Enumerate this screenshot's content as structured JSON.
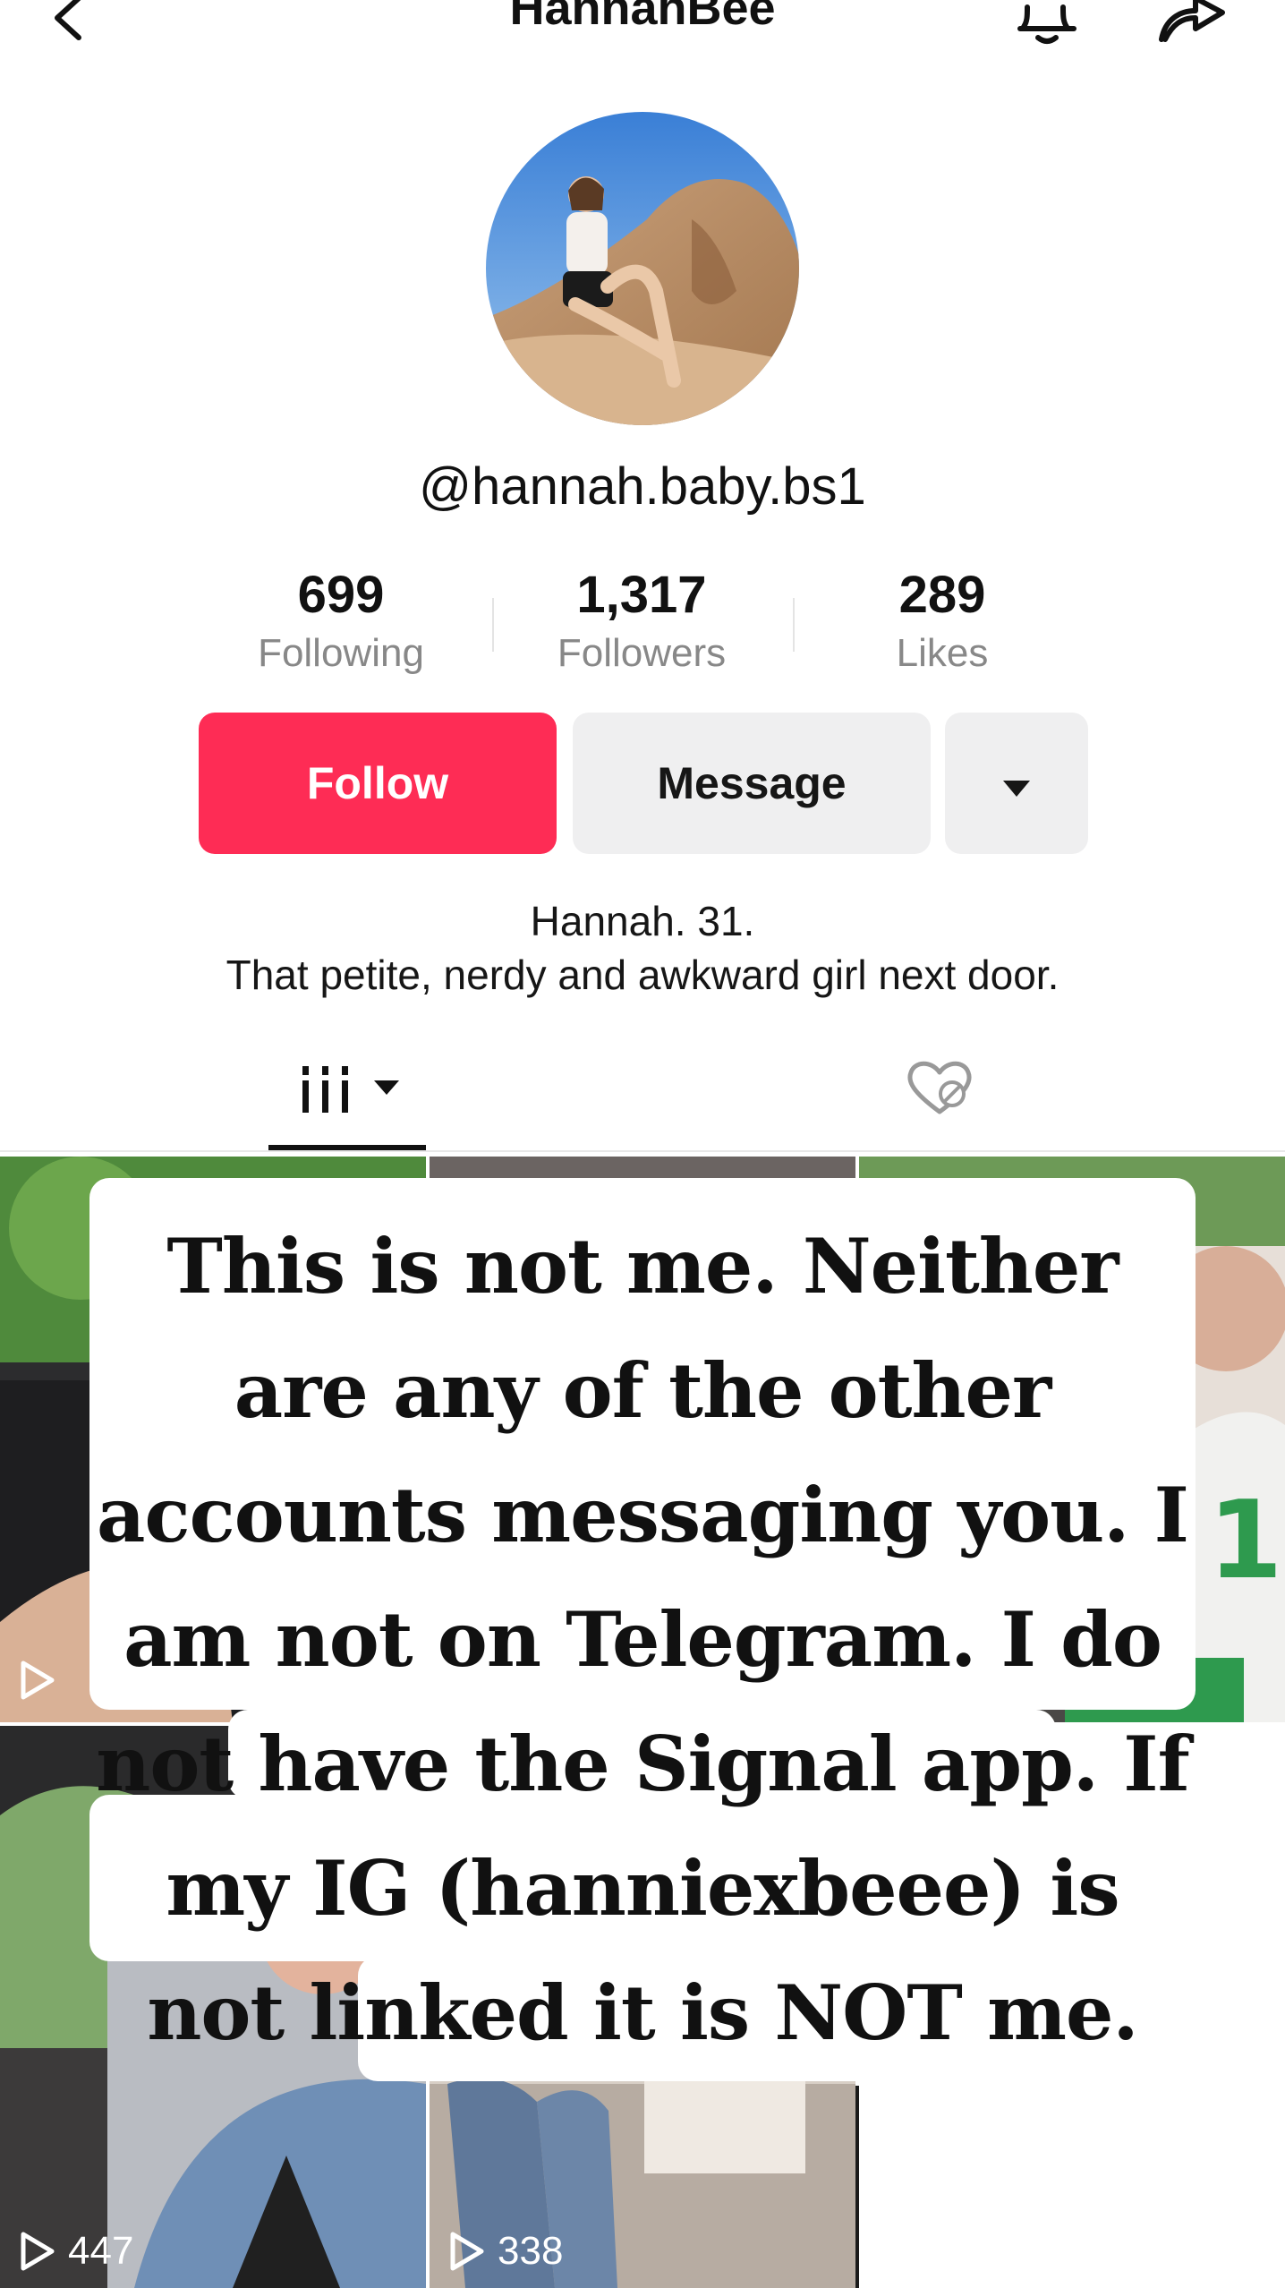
{
  "header": {
    "title": "HannahBee"
  },
  "profile": {
    "handle": "@hannah.baby.bs1",
    "stats": [
      {
        "value": "699",
        "label": "Following"
      },
      {
        "value": "1,317",
        "label": "Followers"
      },
      {
        "value": "289",
        "label": "Likes"
      }
    ],
    "bio_line1": "Hannah. 31.",
    "bio_line2": "That petite, nerdy and awkward girl next door."
  },
  "actions": {
    "follow_label": "Follow",
    "message_label": "Message"
  },
  "tabs": [
    {
      "icon": "grid-icon",
      "active": true
    },
    {
      "icon": "liked-hidden-icon",
      "active": false
    }
  ],
  "grid": {
    "view_counts": [
      "447",
      "338"
    ]
  },
  "notice": {
    "text": "This is not me. Neither are any of the other accounts messaging you. I am not on Telegram. I do not have the Signal app. If my IG (hanniexbeee) is not linked it is NOT me."
  },
  "colors": {
    "accent": "#fe2c55",
    "secondary_button": "#efeff0"
  }
}
